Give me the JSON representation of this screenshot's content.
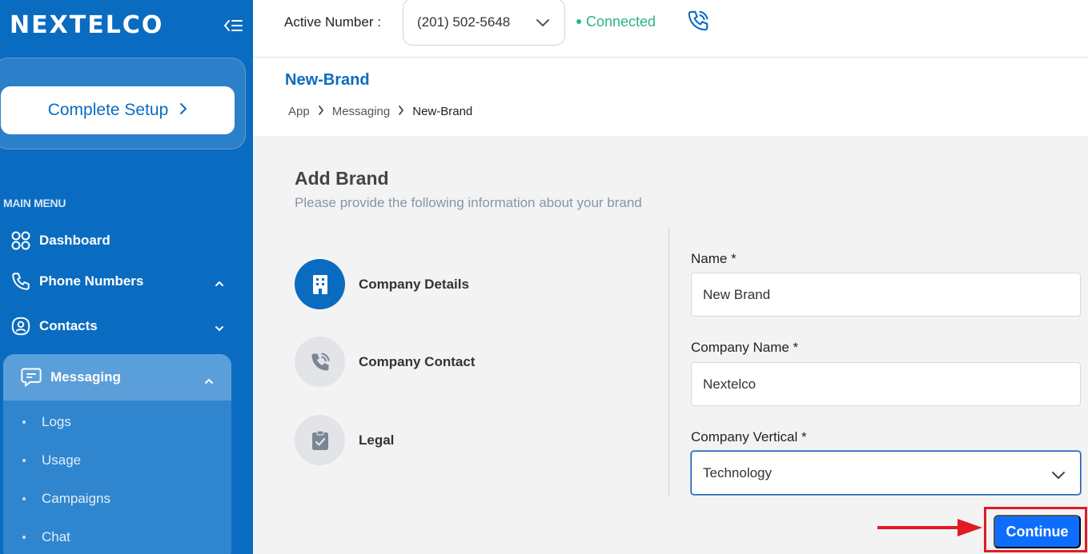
{
  "sidebar": {
    "logo": "NEXTELCO",
    "complete_setup": "Complete Setup",
    "menu_heading": "MAIN MENU",
    "items": [
      {
        "label": "Dashboard",
        "icon": "grid-icon"
      },
      {
        "label": "Phone Numbers",
        "icon": "phone-icon"
      },
      {
        "label": "Contacts",
        "icon": "contact-icon"
      }
    ],
    "messaging": {
      "label": "Messaging",
      "icon": "chat-icon",
      "sub_items": [
        "Logs",
        "Usage",
        "Campaigns",
        "Chat"
      ]
    }
  },
  "topbar": {
    "active_number_label": "Active Number :",
    "active_number": "(201) 502-5648",
    "status": "Connected",
    "status_color": "#2fb37e"
  },
  "page": {
    "title": "New-Brand",
    "breadcrumb": [
      "App",
      "Messaging",
      "New-Brand"
    ]
  },
  "form": {
    "title": "Add Brand",
    "subtitle": "Please provide the following information about your brand",
    "steps": [
      {
        "label": "Company Details",
        "icon": "building-icon",
        "active": true
      },
      {
        "label": "Company Contact",
        "icon": "phone-call-icon",
        "active": false
      },
      {
        "label": "Legal",
        "icon": "clipboard-check-icon",
        "active": false
      }
    ],
    "fields": {
      "name_label": "Name *",
      "name_value": "New Brand",
      "company_name_label": "Company Name *",
      "company_name_value": "Nextelco",
      "vertical_label": "Company Vertical *",
      "vertical_value": "Technology"
    },
    "continue_label": "Continue"
  },
  "colors": {
    "brand": "#0a6cc0",
    "button": "#0d6efd",
    "highlight": "#e01b24"
  }
}
